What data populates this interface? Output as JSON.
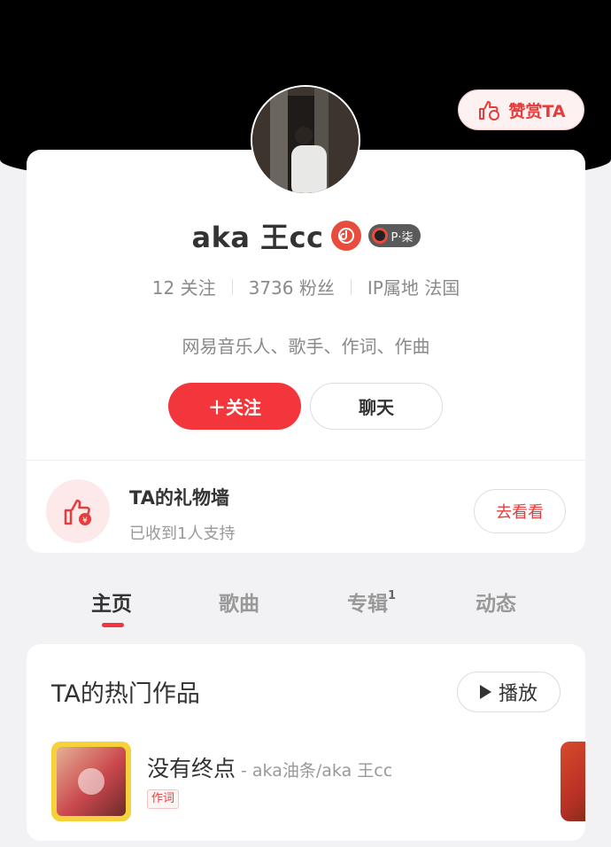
{
  "header": {
    "reward_label": "赞赏TA"
  },
  "profile": {
    "name": "aka 王cc",
    "level_badge": "P·柒",
    "stats": [
      {
        "label": "12 关注"
      },
      {
        "label": "3736 粉丝"
      },
      {
        "label": "IP属地 法国"
      }
    ],
    "bio": "网易音乐人、歌手、作词、作曲",
    "follow_label": "＋关注",
    "chat_label": "聊天"
  },
  "gift_wall": {
    "title": "TA的礼物墙",
    "subtitle": "已收到1人支持",
    "button_label": "去看看"
  },
  "tabs": [
    {
      "label": "主页",
      "active": true,
      "badge": ""
    },
    {
      "label": "歌曲",
      "active": false,
      "badge": ""
    },
    {
      "label": "专辑",
      "active": false,
      "badge": "1"
    },
    {
      "label": "动态",
      "active": false,
      "badge": ""
    }
  ],
  "works": {
    "title": "TA的热门作品",
    "play_label": "播放",
    "songs": [
      {
        "title": "没有终点",
        "artist": "- aka油条/aka 王cc",
        "tag": "作词"
      }
    ]
  },
  "colors": {
    "accent": "#f2363b",
    "hero_bg": "#000000",
    "page_bg": "#f2f2f4"
  }
}
